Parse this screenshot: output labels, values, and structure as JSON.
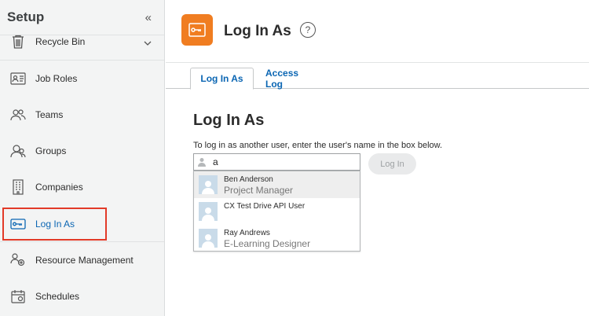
{
  "sidebar": {
    "title": "Setup",
    "collapse_glyph": "«",
    "items": [
      {
        "label": "Recycle Bin",
        "icon": "trash-icon"
      },
      {
        "label": "Job Roles",
        "icon": "id-card-icon"
      },
      {
        "label": "Teams",
        "icon": "team-icon"
      },
      {
        "label": "Groups",
        "icon": "groups-icon"
      },
      {
        "label": "Companies",
        "icon": "building-icon"
      },
      {
        "label": "Log In As",
        "icon": "key-icon",
        "active": true
      },
      {
        "label": "Resource Management",
        "icon": "resource-icon"
      },
      {
        "label": "Schedules",
        "icon": "calendar-icon"
      }
    ]
  },
  "header": {
    "title": "Log In As",
    "help_glyph": "?",
    "accent_color": "#f07d21"
  },
  "tabs": [
    {
      "label": "Log In As",
      "active": true
    },
    {
      "label": "Access Log",
      "active": false
    }
  ],
  "main": {
    "title": "Log In As",
    "instructions": "To log in as another user, enter the user's name in the box below.",
    "search_value": "a",
    "login_button": "Log In"
  },
  "dropdown": [
    {
      "name": "Ben Anderson",
      "role": "Project Manager",
      "highlighted": true
    },
    {
      "name": "CX Test Drive API User",
      "role": "",
      "highlighted": false
    },
    {
      "name": "Ray Andrews",
      "role": "E-Learning Designer",
      "highlighted": false
    }
  ],
  "colors": {
    "link": "#0b66b3",
    "highlight_border": "#e23a28",
    "sidebar_bg": "#f3f4f4"
  }
}
